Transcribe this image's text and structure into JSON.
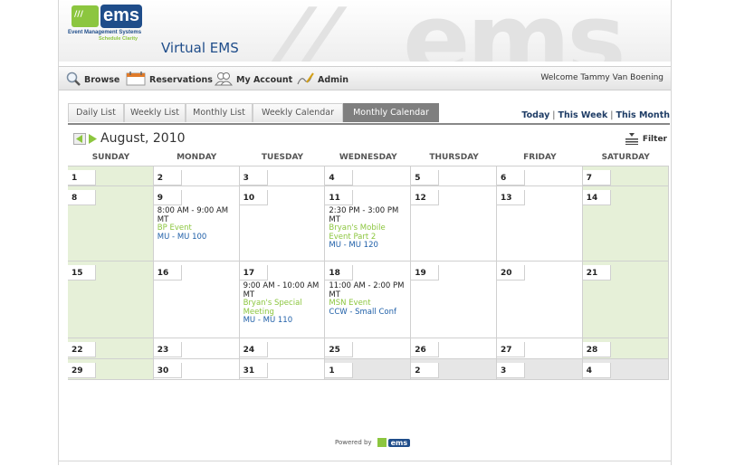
{
  "header": {
    "logo_text": "ems",
    "logo_subtitle": "Event Management Systems",
    "logo_tagline": "Schedule Clarity",
    "app_title": "Virtual EMS"
  },
  "nav": {
    "items": [
      {
        "label": "Browse",
        "icon": "magnifier-icon"
      },
      {
        "label": "Reservations",
        "icon": "calendar-icon"
      },
      {
        "label": "My Account",
        "icon": "people-icon"
      },
      {
        "label": "Admin",
        "icon": "pencil-icon"
      }
    ],
    "welcome": "Welcome Tammy Van Boening"
  },
  "tabs": [
    {
      "label": "Daily List"
    },
    {
      "label": "Weekly List"
    },
    {
      "label": "Monthly List"
    },
    {
      "label": "Weekly Calendar"
    },
    {
      "label": "Monthly Calendar",
      "active": true
    }
  ],
  "quick_links": {
    "today": "Today",
    "this_week": "This Week",
    "this_month": "This Month",
    "separator": "|"
  },
  "calendar": {
    "month_title": "August, 2010",
    "filter_label": "Filter",
    "weekdays": [
      "SUNDAY",
      "MONDAY",
      "TUESDAY",
      "WEDNESDAY",
      "THURSDAY",
      "FRIDAY",
      "SATURDAY"
    ],
    "weeks": [
      {
        "days": [
          {
            "day": "1"
          },
          {
            "day": "2"
          },
          {
            "day": "3"
          },
          {
            "day": "4"
          },
          {
            "day": "5"
          },
          {
            "day": "6"
          },
          {
            "day": "7"
          }
        ]
      },
      {
        "days": [
          {
            "day": "8"
          },
          {
            "day": "9",
            "events": [
              {
                "time": "8:00 AM - 9:00 AM MT",
                "name": "BP Event",
                "location": "MU - MU 100"
              }
            ]
          },
          {
            "day": "10"
          },
          {
            "day": "11",
            "events": [
              {
                "time": "2:30 PM - 3:00 PM MT",
                "name": "Bryan's Mobile Event Part 2",
                "location": "MU - MU 120"
              }
            ]
          },
          {
            "day": "12"
          },
          {
            "day": "13"
          },
          {
            "day": "14"
          }
        ]
      },
      {
        "days": [
          {
            "day": "15"
          },
          {
            "day": "16"
          },
          {
            "day": "17",
            "events": [
              {
                "time": "9:00 AM - 10:00 AM MT",
                "name": "Bryan's Special Meeting",
                "location": "MU - MU 110"
              }
            ]
          },
          {
            "day": "18",
            "events": [
              {
                "time": "11:00 AM - 2:00 PM MT",
                "name": "MSN Event",
                "location": "CCW - Small Conf"
              }
            ]
          },
          {
            "day": "19"
          },
          {
            "day": "20"
          },
          {
            "day": "21"
          }
        ]
      },
      {
        "days": [
          {
            "day": "22"
          },
          {
            "day": "23"
          },
          {
            "day": "24"
          },
          {
            "day": "25"
          },
          {
            "day": "26"
          },
          {
            "day": "27"
          },
          {
            "day": "28"
          }
        ]
      },
      {
        "days": [
          {
            "day": "29"
          },
          {
            "day": "30"
          },
          {
            "day": "31"
          },
          {
            "day": "1",
            "other_month": true
          },
          {
            "day": "2",
            "other_month": true
          },
          {
            "day": "3",
            "other_month": true
          },
          {
            "day": "4",
            "other_month": true
          }
        ]
      }
    ]
  },
  "footer": {
    "powered_by": "Powered by",
    "logo_text": "ems"
  },
  "colors": {
    "brand_blue": "#1f4d8a",
    "brand_green": "#8cc63f",
    "weekend_bg": "#e6f0d8",
    "event_location": "#1f5fa8"
  }
}
